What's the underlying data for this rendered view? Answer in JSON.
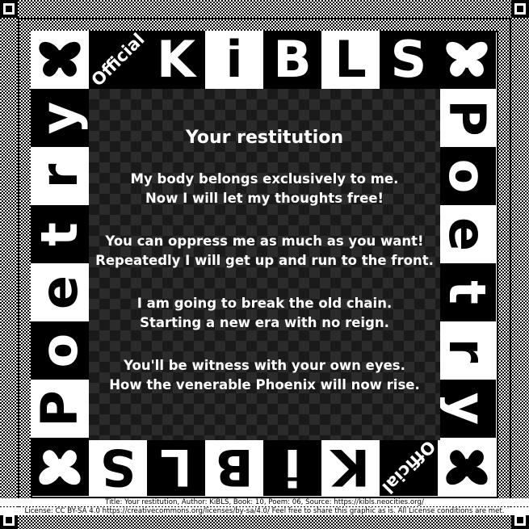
{
  "brand": {
    "word_top": [
      "K",
      "i",
      "B",
      "L",
      "S"
    ],
    "word_side": [
      "P",
      "o",
      "e",
      "t",
      "r",
      "y"
    ],
    "official_label": "Official"
  },
  "poem": {
    "title": "Your restitution",
    "stanzas": [
      [
        "My body belongs exclusively to me.",
        "Now I will let my thoughts free!"
      ],
      [
        "You can oppress me as much as you want!",
        "Repeatedly I will get up and run to the front."
      ],
      [
        "I am going to break the old chain.",
        "Starting a new era with no reign."
      ],
      [
        "You'll be witness with your own eyes.",
        "How the venerable Phoenix will now rise."
      ]
    ]
  },
  "footer": {
    "line1": "Title: Your restitution, Author: KiBLS, Book: 10, Poem: 06, Source: https://kibls.neocities.org/",
    "line2": "License: CC BY-SA 4.0 https://creativecommons.org/licenses/by-sa/4.0/ Feel free to share this graphic as is. All License conditions are met."
  },
  "icons": [
    "butterfly-icon"
  ],
  "colors": {
    "dark": "#000000",
    "light": "#ffffff",
    "center_dark": "#2b2b2b"
  }
}
